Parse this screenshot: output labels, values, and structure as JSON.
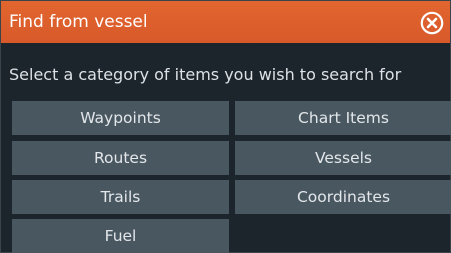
{
  "dialog": {
    "title": "Find from vessel",
    "close_icon": "close-circle-icon",
    "prompt": "Select a category of items you wish to search for"
  },
  "categories": [
    {
      "label": "Waypoints"
    },
    {
      "label": "Chart Items"
    },
    {
      "label": "Routes"
    },
    {
      "label": "Vessels"
    },
    {
      "label": "Trails"
    },
    {
      "label": "Coordinates"
    },
    {
      "label": "Fuel"
    }
  ],
  "colors": {
    "titlebar": "#e2662f",
    "background": "#1c252c",
    "button": "#495761",
    "text": "#dde2e6"
  }
}
